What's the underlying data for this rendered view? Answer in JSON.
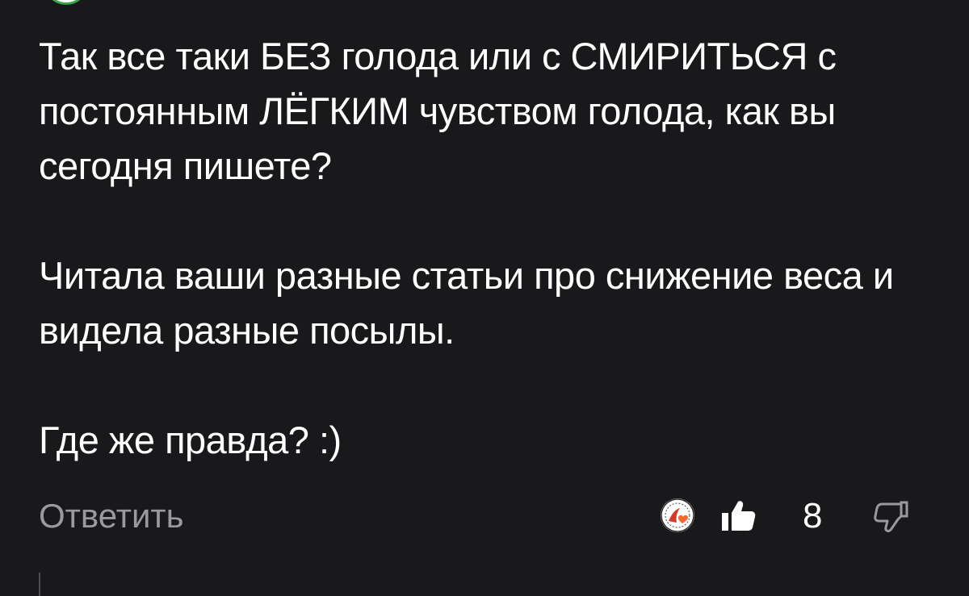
{
  "comment": {
    "paragraph_1": "Так все таки БЕЗ голода или с СМИРИТЬСЯ с постоянным ЛЁГКИМ чувством голода, как вы сегодня пишете?",
    "paragraph_2": "Читала ваши разные статьи про снижение веса и видела разные посылы.",
    "paragraph_3": "Где же правда? :)"
  },
  "actions": {
    "reply_label": "Ответить",
    "like_count": "8"
  },
  "icons": {
    "liker_avatar": "liker-avatar-icon",
    "like": "thumbs-up-icon",
    "dislike": "thumbs-down-icon"
  },
  "colors": {
    "background": "#19181b",
    "text": "#ffffff",
    "muted": "#9a9a9e",
    "accent_heart": "#f26a2e"
  }
}
